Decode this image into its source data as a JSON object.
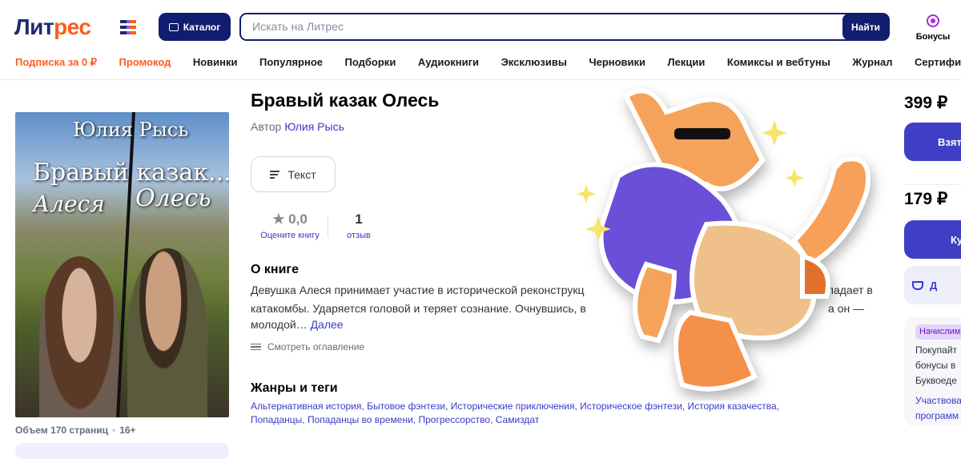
{
  "header": {
    "logo": {
      "part1": "Лит",
      "part2": "рес"
    },
    "catalog_label": "Каталог",
    "search_placeholder": "Искать на Литрес",
    "search_button": "Найти",
    "bonus_label": "Бонусы"
  },
  "nav": [
    "Подписка за 0 ₽",
    "Промокод",
    "Новинки",
    "Популярное",
    "Подборки",
    "Аудиокниги",
    "Эксклюзивы",
    "Черновики",
    "Лекции",
    "Комиксы и вебтуны",
    "Журнал",
    "Сертификаты"
  ],
  "cover": {
    "author": "Юлия Рысь",
    "title": "Бравый казак...",
    "name1": "Алеся",
    "name2": "Олесь"
  },
  "book": {
    "title": "Бравый казак Олесь",
    "author_prefix": "Автор",
    "author": "Юлия Рысь",
    "format": "Текст",
    "rating": "★ 0,0",
    "rate_label": "Оцените книгу",
    "reviews_count": "1",
    "reviews_label": "отзыв",
    "volume": "Объем 170 страниц",
    "age": "16+"
  },
  "about": {
    "heading": "О книге",
    "lines": [
      {
        "left": "Девушка Алеся принимает участие в исторической реконструкц",
        "right": "ю падает в"
      },
      {
        "left": "катакомбы. Ударяется головой и теряет сознание. Очнувшись, в",
        "right": "а он —"
      },
      {
        "left": "молодой…"
      }
    ],
    "more": "Далее",
    "toc": "Смотреть оглавление"
  },
  "genres": {
    "heading": "Жанры и теги",
    "tags": [
      "Альтернативная история",
      "Бытовое фэнтези",
      "Исторические приключения",
      "Историческое фэнтези",
      "История казачества",
      "Попаданцы",
      "Попаданцы во времени",
      "Прогрессорство",
      "Самиздат"
    ]
  },
  "purchase": {
    "price1": "399 ₽",
    "btn1": "Взять",
    "price2": "179 ₽",
    "btn2": "Купить",
    "btn3": "Д",
    "promo_badge": "Начислим",
    "promo_lines": [
      "Покупайт",
      "бонусы в",
      "Буквоеде"
    ],
    "promo_link": [
      "Участвова",
      "программ"
    ]
  }
}
